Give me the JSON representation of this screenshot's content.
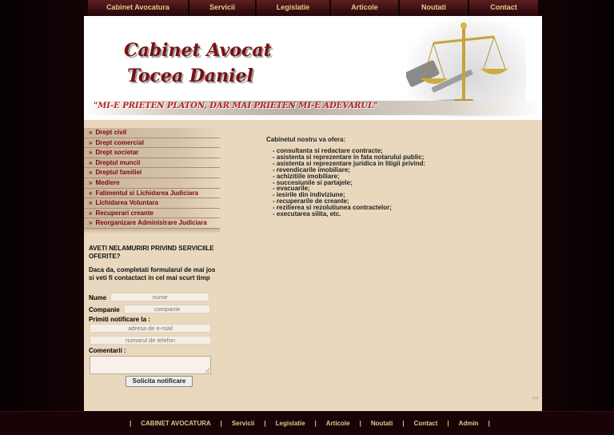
{
  "top_nav": [
    "Cabinet Avocatura",
    "Servicii",
    "Legislatie",
    "Articole",
    "Noutati",
    "Contact"
  ],
  "header": {
    "title_line1": "Cabinet Avocat",
    "title_line2": "Tocea Daniel",
    "motto": "\"MI-E PRIETEN PLATON, DAR MAI PRIETEN MI-E ADEVARUL\"",
    "logo_icon": "scales-of-justice-icon"
  },
  "sidebar": {
    "items": [
      "Drept civil",
      "Drept comercial",
      "Drept societar",
      "Dreptul muncii",
      "Dreptul familiei",
      "Mediere",
      "Falimentul si Lichidarea Judiciara",
      "Lichidarea Voluntara",
      "Recuperari creante",
      "Reorganizare Administrare Judiciara"
    ]
  },
  "main": {
    "intro": "Cabinetul nostru va ofera:",
    "services": [
      "- consultanta si redactare contracte;",
      "- asistenta si reprezentare in fata notarului public;",
      "- asistenta si reprezentare juridica in litigii privind:",
      "- revendicarile imobiliare;",
      "- achizitiile imobiliare;",
      "- succesiunile si partajele;",
      "- evacuarile;",
      "- iesirile din indiviziune;",
      "- recuperarile de creante;",
      "- rezilierea si rezolutiunea contractelor;",
      "- executarea silita, etc."
    ]
  },
  "form": {
    "heading": "AVETI NELAMURIRI PRIVIND SERVICIILE OFERITE?",
    "subheading": "Daca da, completati formularul de mai jos si veti fi contactact in cel mai scurt timp",
    "name_label": "Nume",
    "name_placeholder": "nume",
    "company_label": "Companie",
    "company_placeholder": "companie",
    "notify_label": "Primiti notificare la :",
    "email_placeholder": "adresa de e-mail",
    "phone_placeholder": "numarul de telefon",
    "comments_label": "Comentarii :",
    "submit_label": "Solicita notificare"
  },
  "corner_mark": "<<",
  "footer": {
    "separator": "|",
    "links": [
      "CABINET AVOCATURA",
      "Servicii",
      "Legislatie",
      "Articole",
      "Noutati",
      "Contact",
      "Admin"
    ]
  },
  "colors": {
    "nav_text": "#e5c98a",
    "accent_red": "#7b0b10",
    "content_bg": "#e9d8bd",
    "page_dark": "#2a070c"
  }
}
